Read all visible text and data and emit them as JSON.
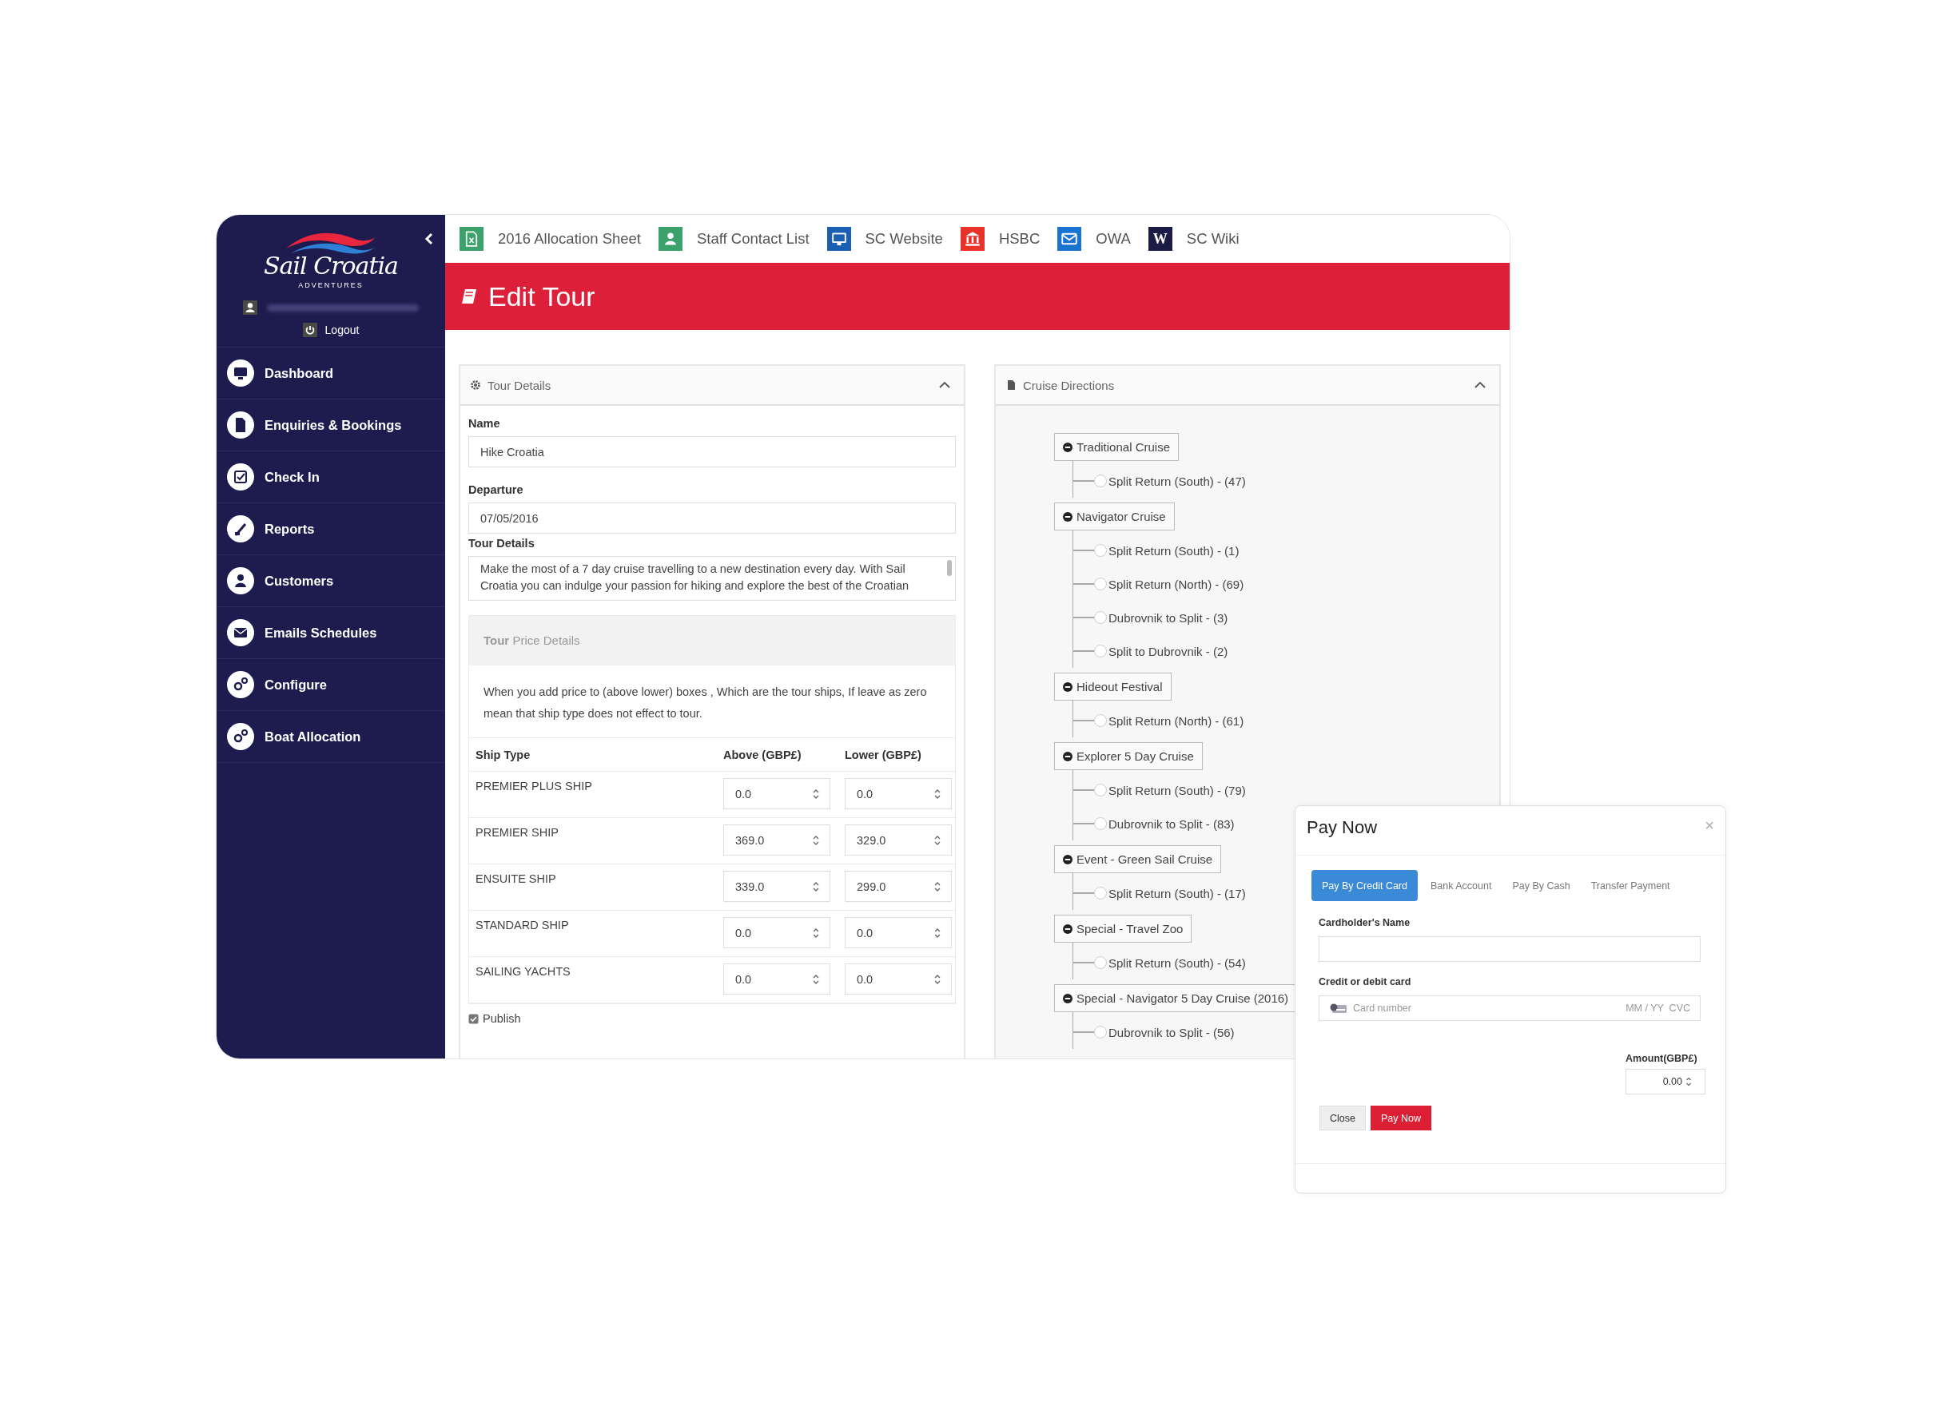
{
  "sidebar": {
    "logo": {
      "name": "Sail Croatia",
      "tagline": "ADVENTURES"
    },
    "logout": "Logout",
    "items": [
      {
        "label": "Dashboard"
      },
      {
        "label": "Enquiries & Bookings"
      },
      {
        "label": "Check In"
      },
      {
        "label": "Reports"
      },
      {
        "label": "Customers"
      },
      {
        "label": "Emails Schedules"
      },
      {
        "label": "Configure"
      },
      {
        "label": "Boat Allocation"
      }
    ]
  },
  "bookmarks": [
    {
      "label": "2016 Allocation Sheet",
      "color": "#3aa26a"
    },
    {
      "label": "Staff Contact List",
      "color": "#3aa26a"
    },
    {
      "label": "SC Website",
      "color": "#1a5fb4"
    },
    {
      "label": "HSBC",
      "color": "#e8322a"
    },
    {
      "label": "OWA",
      "color": "#1a73d0"
    },
    {
      "label": "SC Wiki",
      "color": "#1b1c45",
      "glyph": "W"
    }
  ],
  "header": {
    "title": "Edit Tour"
  },
  "tour_details": {
    "title": "Tour Details",
    "expanded": true,
    "name": {
      "label": "Name",
      "value": "Hike Croatia"
    },
    "departure": {
      "label": "Departure",
      "value": "07/05/2016"
    },
    "details": {
      "label": "Tour Details",
      "value": "Make the most of a 7 day cruise travelling to a new destination every day. With Sail Croatia you can indulge your passion for hiking and explore the best of the Croatian"
    },
    "price": {
      "title": "**Tour** Price Details",
      "note": "When you add price to (above lower) boxes , Which are the tour ships, If leave as zero mean that ship type does not effect to tour.",
      "columns": [
        "Ship Type",
        "Above (GBP£)",
        "Lower (GBP£)"
      ],
      "rows": [
        {
          "ship_type": "PREMIER PLUS SHIP",
          "above": "0.0",
          "lower": "0.0"
        },
        {
          "ship_type": "PREMIER SHIP",
          "above": "369.0",
          "lower": "329.0"
        },
        {
          "ship_type": "ENSUITE SHIP",
          "above": "339.0",
          "lower": "299.0"
        },
        {
          "ship_type": "STANDARD SHIP",
          "above": "0.0",
          "lower": "0.0"
        },
        {
          "ship_type": "SAILING YACHTS",
          "above": "0.0",
          "lower": "0.0"
        }
      ]
    },
    "publish": {
      "label": "Publish",
      "checked": true
    }
  },
  "cruise_directions": {
    "title": "Cruise Directions",
    "expanded": true,
    "tree": [
      {
        "label": "Traditional Cruise",
        "expanded": true,
        "children": [
          {
            "label": "Split Return (South) - (47)",
            "selected": false
          }
        ]
      },
      {
        "label": "Navigator Cruise",
        "expanded": true,
        "children": [
          {
            "label": "Split Return (South) - (1)",
            "selected": false
          },
          {
            "label": "Split Return (North) - (69)",
            "selected": false
          },
          {
            "label": "Dubrovnik to Split - (3)",
            "selected": false
          },
          {
            "label": "Split to Dubrovnik - (2)",
            "selected": false
          }
        ]
      },
      {
        "label": "Hideout Festival",
        "expanded": true,
        "children": [
          {
            "label": "Split Return (North) - (61)",
            "selected": false
          }
        ]
      },
      {
        "label": "Explorer 5 Day Cruise",
        "expanded": true,
        "children": [
          {
            "label": "Split Return (South) - (79)",
            "selected": false
          },
          {
            "label": "Dubrovnik to Split - (83)",
            "selected": false
          }
        ]
      },
      {
        "label": "Event - Green Sail Cruise",
        "expanded": true,
        "children": [
          {
            "label": "Split Return (South) - (17)",
            "selected": false
          }
        ]
      },
      {
        "label": "Special - Travel Zoo",
        "expanded": true,
        "children": [
          {
            "label": "Split Return (South) - (54)",
            "selected": false
          }
        ]
      },
      {
        "label": "Special - Navigator 5 Day Cruise (2016)",
        "expanded": true,
        "children": [
          {
            "label": "Dubrovnik to Split - (56)",
            "selected": false
          }
        ]
      }
    ]
  },
  "modal": {
    "title": "Pay Now",
    "close": "×",
    "tabs": [
      {
        "label": "Pay By Credit Card",
        "selected": true
      },
      {
        "label": "Bank Account",
        "selected": false
      },
      {
        "label": "Pay By Cash",
        "selected": false
      },
      {
        "label": "Transfer Payment",
        "selected": false
      }
    ],
    "cardholder": {
      "label": "Cardholder's Name"
    },
    "card": {
      "label": "Credit or debit card",
      "placeholder": "Card number",
      "extra": "MM / YY  CVC"
    },
    "amount": {
      "label": "Amount(GBP£)",
      "value": "0.00"
    },
    "buttons": [
      {
        "label": "Close",
        "kind": "default"
      },
      {
        "label": "Pay Now",
        "kind": "primary"
      }
    ]
  }
}
